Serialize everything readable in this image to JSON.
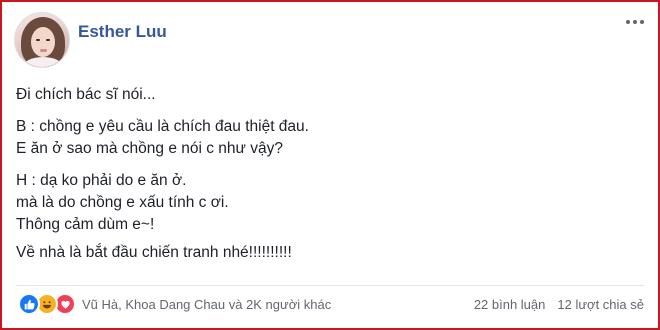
{
  "post": {
    "author": "Esther Luu",
    "lines": [
      "Đi chích bác sĩ nói...",
      "B : chồng e yêu cầu là chích đau thiệt đau.",
      "E ăn ở sao mà chồng e nói c như vậy?",
      "H : dạ ko phải do e ăn ở.",
      "mà là do chồng e xấu tính c ơi.",
      "Thông cảm dùm e~!",
      "Về nhà là bắt đầu chiến tranh nhé!!!!!!!!!!"
    ]
  },
  "footer": {
    "reactions": [
      "like",
      "haha",
      "love"
    ],
    "reacted_by": "Vũ Hà, Khoa Dang Chau và 2K người khác",
    "comments": "22 bình luận",
    "shares": "12 lượt chia sẻ"
  },
  "colors": {
    "author": "#365899",
    "border": "#c9171e",
    "like": "#1877f2",
    "haha": "#f7b125",
    "love": "#f33e58"
  }
}
